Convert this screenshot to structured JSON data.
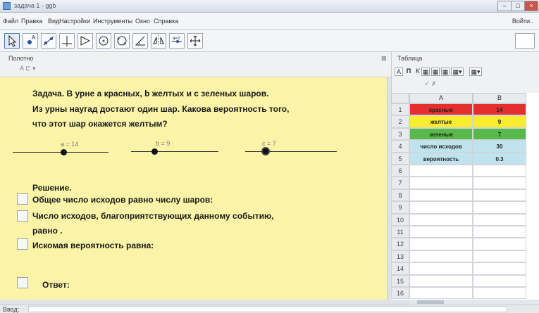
{
  "window": {
    "title": "задача 1 - ggb",
    "min_label": "–",
    "max_label": "□",
    "close_label": "×"
  },
  "menubar": {
    "items": [
      "Файл",
      "Правка",
      "Вид",
      "Настройки",
      "Инструменты",
      "Окно",
      "Справка"
    ],
    "login": "Войти.."
  },
  "toolbar": {
    "tools": [
      "move-tool-icon",
      "point-tool-icon",
      "line-tool-icon",
      "perpendicular-line-icon",
      "polygon-tool-icon",
      "circle-tool-icon",
      "conic-tool-icon",
      "angle-tool-icon",
      "reflect-tool-icon",
      "slider-tool-icon",
      "move-view-icon"
    ]
  },
  "graphics": {
    "panel_title": "Полотно",
    "close_label": "⊠",
    "sub_tools": "A  ⊏ ▾",
    "task_lines": [
      "Задача. В урне а красных, b желтых и с зеленых шаров.",
      "Из урны наугад достают один шар. Какова вероятность того,",
      "что этот шар окажется желтым?"
    ],
    "sliders": [
      {
        "label": "a = 14"
      },
      {
        "label": "b = 9"
      },
      {
        "label": "c = 7"
      }
    ],
    "solution_title": "Решение.",
    "solution_lines": [
      "Общее число исходов равно числу шаров:",
      "Число исходов, благоприятствующих данному событию,",
      "равно      .",
      "Искомая вероятность равна:"
    ],
    "answer_label": "Ответ:"
  },
  "spreadsheet": {
    "panel_title": "Таблица",
    "tool_labels": [
      "A",
      "П",
      "K",
      "▦",
      "▦",
      "▦",
      "▦▾",
      "▦▾"
    ],
    "formula_hint": "✓ ✗",
    "columns": [
      "A",
      "B"
    ],
    "rows": [
      {
        "n": "1",
        "a": "красные",
        "b": "14",
        "color": "#e52e2e"
      },
      {
        "n": "2",
        "a": "желтые",
        "b": "9",
        "color": "#f7ec2d"
      },
      {
        "n": "3",
        "a": "зеленые",
        "b": "7",
        "color": "#57b949"
      },
      {
        "n": "4",
        "a": "число исходов",
        "b": "30",
        "color": "#bfe4ef"
      },
      {
        "n": "5",
        "a": "вероятность",
        "b": "0.3",
        "color": "#bfe4ef"
      },
      {
        "n": "6",
        "a": "",
        "b": "",
        "color": ""
      },
      {
        "n": "7",
        "a": "",
        "b": "",
        "color": ""
      },
      {
        "n": "8",
        "a": "",
        "b": "",
        "color": ""
      },
      {
        "n": "9",
        "a": "",
        "b": "",
        "color": ""
      },
      {
        "n": "10",
        "a": "",
        "b": "",
        "color": ""
      },
      {
        "n": "11",
        "a": "",
        "b": "",
        "color": ""
      },
      {
        "n": "12",
        "a": "",
        "b": "",
        "color": ""
      },
      {
        "n": "13",
        "a": "",
        "b": "",
        "color": ""
      },
      {
        "n": "14",
        "a": "",
        "b": "",
        "color": ""
      },
      {
        "n": "15",
        "a": "",
        "b": "",
        "color": ""
      },
      {
        "n": "16",
        "a": "",
        "b": "",
        "color": ""
      }
    ]
  },
  "input_bar": {
    "label": "Ввод:"
  }
}
